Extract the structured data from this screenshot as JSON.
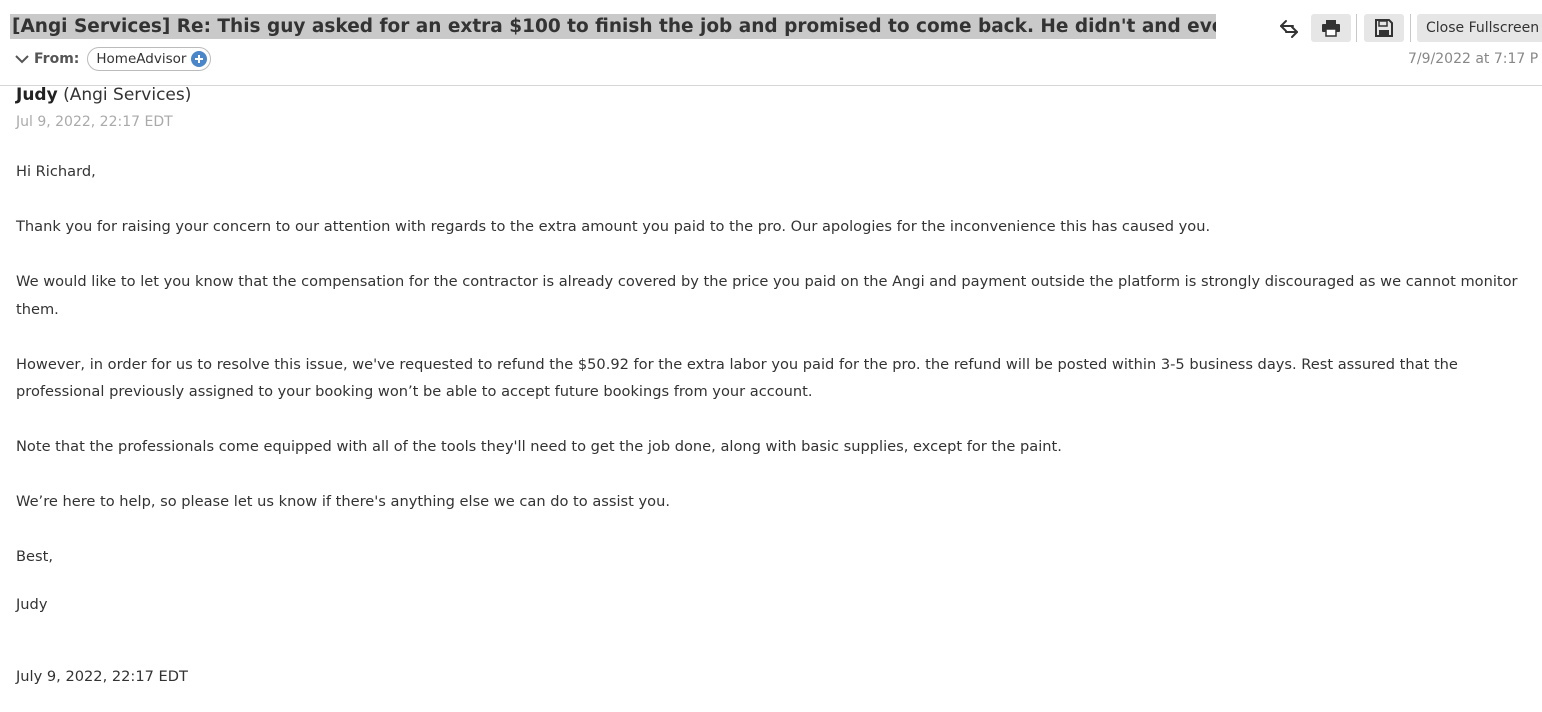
{
  "header": {
    "subject": "[Angi Services] Re: This guy asked for an extra $100 to finish the job and promised to come back. He didn't and even bloc...",
    "close_label": "Close Fullscreen",
    "from_label": "From:",
    "sender_pill": "HomeAdvisor",
    "date": "7/9/2022 at 7:17 P"
  },
  "message": {
    "sender_name": "Judy",
    "sender_org": "(Angi Services)",
    "sent_time": "Jul 9, 2022, 22:17 EDT",
    "paragraphs": [
      "Hi Richard,",
      "Thank you for raising your concern to our attention with regards to the extra amount you paid to the pro. Our apologies for the inconvenience this has caused you.",
      "We would like to let you know that the compensation for the contractor is already covered by the price you paid on the Angi and payment outside the platform is strongly discouraged as we cannot monitor them.",
      "However, in order for us to resolve this issue, we've requested to refund the $50.92 for the extra labor you paid for the pro. the refund will be posted within 3-5 business days. Rest assured that the professional previously assigned to your booking won’t be able to accept future bookings from your account.",
      "Note that the professionals come equipped with all of the tools they'll need to get the job done, along with basic supplies, except for the paint.",
      "We’re here to help, so please let us know if there's anything else we can do to assist you.",
      "Best,",
      "Judy"
    ],
    "footer_time": "July 9, 2022, 22:17 EDT"
  },
  "icons": {
    "reply_all": "reply-all-icon",
    "print": "print-icon",
    "save": "save-icon",
    "expand": "chevron-down-icon",
    "add_contact": "plus-circle-icon"
  },
  "colors": {
    "subject_highlight": "#c9c9c9",
    "button_bg": "#e6e6e6",
    "plus_icon": "#4a86c8",
    "muted_text": "#aaaaaa"
  }
}
